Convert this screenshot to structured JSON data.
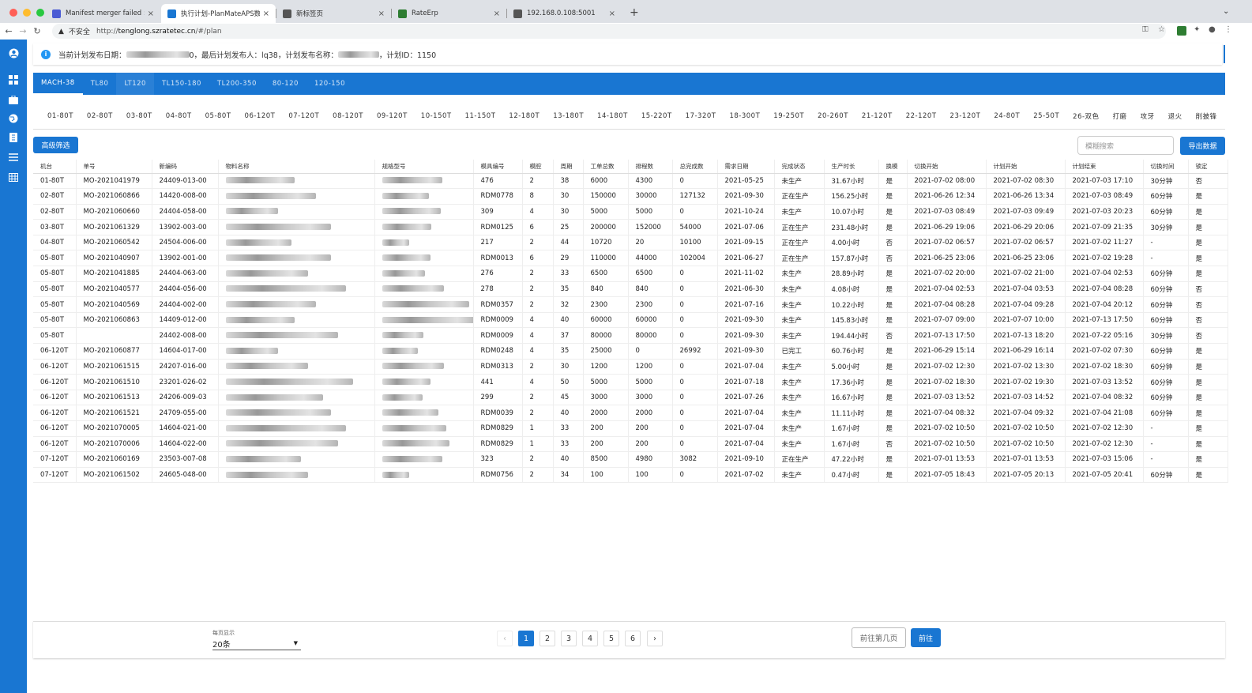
{
  "browser": {
    "tabs": [
      {
        "title": "Manifest merger failed : andro",
        "color": "#4a5bd4"
      },
      {
        "title": "执行计划-PlanMateAPS数据中心",
        "color": "#1976d2"
      },
      {
        "title": "新标签页",
        "color": "#555"
      },
      {
        "title": "RateErp",
        "color": "#2e7d32"
      },
      {
        "title": "192.168.0.108:5001",
        "color": "#555"
      }
    ],
    "insecure_label": "不安全",
    "url_prefix": "http://",
    "url_host": "tenglong.szratetec.cn",
    "url_path": "/#/plan"
  },
  "info": {
    "text_a": "当前计划发布日期：",
    "text_b": "0，最后计划发布人：lq38，计划发布名称：",
    "text_c": "，计划ID：1150"
  },
  "machine_tabs": [
    "MACH-38",
    "TL80",
    "LT120",
    "TL150-180",
    "TL200-350",
    "80-120",
    "120-150"
  ],
  "sub_tabs": [
    "01-80T",
    "02-80T",
    "03-80T",
    "04-80T",
    "05-80T",
    "06-120T",
    "07-120T",
    "08-120T",
    "09-120T",
    "10-150T",
    "11-150T",
    "12-180T",
    "13-180T",
    "14-180T",
    "15-220T",
    "17-320T",
    "18-300T",
    "19-250T",
    "20-260T",
    "21-120T",
    "22-120T",
    "23-120T",
    "24-80T",
    "25-50T",
    "26-双色",
    "打磨",
    "攻牙",
    "退火",
    "削披锋"
  ],
  "toolbar": {
    "filter_label": "高级筛选",
    "search_placeholder": "模糊搜索",
    "export_label": "导出数据"
  },
  "table": {
    "columns": [
      "机台",
      "单号",
      "新编码",
      "物料名称",
      "规格型号",
      "模具编号",
      "模腔",
      "周期",
      "工单总数",
      "排程数",
      "总完成数",
      "需求日期",
      "完成状态",
      "生产时长",
      "换模",
      "切换开始",
      "计划开始",
      "计划结束",
      "切换时间",
      "锁定"
    ],
    "rows": [
      [
        "01-80T",
        "MO-2021041979",
        "24409-013-00",
        "",
        "",
        "476",
        "2",
        "38",
        "6000",
        "4300",
        "0",
        "2021-05-25",
        "未生产",
        "31.67小时",
        "是",
        "2021-07-02 08:00",
        "2021-07-02 08:30",
        "2021-07-03 17:10",
        "30分钟",
        "否"
      ],
      [
        "02-80T",
        "MO-2021060866",
        "14420-008-00",
        "",
        "",
        "RDM0778",
        "8",
        "30",
        "150000",
        "30000",
        "127132",
        "2021-09-30",
        "正在生产",
        "156.25小时",
        "是",
        "2021-06-26 12:34",
        "2021-06-26 13:34",
        "2021-07-03 08:49",
        "60分钟",
        "是"
      ],
      [
        "02-80T",
        "MO-2021060660",
        "24404-058-00",
        "",
        "",
        "309",
        "4",
        "30",
        "5000",
        "5000",
        "0",
        "2021-10-24",
        "未生产",
        "10.07小时",
        "是",
        "2021-07-03 08:49",
        "2021-07-03 09:49",
        "2021-07-03 20:23",
        "60分钟",
        "是"
      ],
      [
        "03-80T",
        "MO-2021061329",
        "13902-003-00",
        "",
        "",
        "RDM0125",
        "6",
        "25",
        "200000",
        "152000",
        "54000",
        "2021-07-06",
        "正在生产",
        "231.48小时",
        "是",
        "2021-06-29 19:06",
        "2021-06-29 20:06",
        "2021-07-09 21:35",
        "30分钟",
        "是"
      ],
      [
        "04-80T",
        "MO-2021060542",
        "24504-006-00",
        "",
        "",
        "217",
        "2",
        "44",
        "10720",
        "20",
        "10100",
        "2021-09-15",
        "正在生产",
        "4.00小时",
        "否",
        "2021-07-02 06:57",
        "2021-07-02 06:57",
        "2021-07-02 11:27",
        "-",
        "是"
      ],
      [
        "05-80T",
        "MO-2021040907",
        "13902-001-00",
        "",
        "",
        "RDM0013",
        "6",
        "29",
        "110000",
        "44000",
        "102004",
        "2021-06-27",
        "正在生产",
        "157.87小时",
        "否",
        "2021-06-25 23:06",
        "2021-06-25 23:06",
        "2021-07-02 19:28",
        "-",
        "是"
      ],
      [
        "05-80T",
        "MO-2021041885",
        "24404-063-00",
        "",
        "",
        "276",
        "2",
        "33",
        "6500",
        "6500",
        "0",
        "2021-11-02",
        "未生产",
        "28.89小时",
        "是",
        "2021-07-02 20:00",
        "2021-07-02 21:00",
        "2021-07-04 02:53",
        "60分钟",
        "是"
      ],
      [
        "05-80T",
        "MO-2021040577",
        "24404-056-00",
        "",
        "",
        "278",
        "2",
        "35",
        "840",
        "840",
        "0",
        "2021-06-30",
        "未生产",
        "4.08小时",
        "是",
        "2021-07-04 02:53",
        "2021-07-04 03:53",
        "2021-07-04 08:28",
        "60分钟",
        "否"
      ],
      [
        "05-80T",
        "MO-2021040569",
        "24404-002-00",
        "",
        "",
        "RDM0357",
        "2",
        "32",
        "2300",
        "2300",
        "0",
        "2021-07-16",
        "未生产",
        "10.22小时",
        "是",
        "2021-07-04 08:28",
        "2021-07-04 09:28",
        "2021-07-04 20:12",
        "60分钟",
        "否"
      ],
      [
        "05-80T",
        "MO-2021060863",
        "14409-012-00",
        "",
        "",
        "RDM0009",
        "4",
        "40",
        "60000",
        "60000",
        "0",
        "2021-09-30",
        "未生产",
        "145.83小时",
        "是",
        "2021-07-07 09:00",
        "2021-07-07 10:00",
        "2021-07-13 17:50",
        "60分钟",
        "否"
      ],
      [
        "05-80T",
        "",
        "24402-008-00",
        "",
        "",
        "RDM0009",
        "4",
        "37",
        "80000",
        "80000",
        "0",
        "2021-09-30",
        "未生产",
        "194.44小时",
        "否",
        "2021-07-13 17:50",
        "2021-07-13 18:20",
        "2021-07-22 05:16",
        "30分钟",
        "否"
      ],
      [
        "06-120T",
        "MO-2021060877",
        "14604-017-00",
        "",
        "",
        "RDM0248",
        "4",
        "35",
        "25000",
        "0",
        "26992",
        "2021-09-30",
        "已完工",
        "60.76小时",
        "是",
        "2021-06-29 15:14",
        "2021-06-29 16:14",
        "2021-07-02 07:30",
        "60分钟",
        "是"
      ],
      [
        "06-120T",
        "MO-2021061515",
        "24207-016-00",
        "",
        "",
        "RDM0313",
        "2",
        "30",
        "1200",
        "1200",
        "0",
        "2021-07-04",
        "未生产",
        "5.00小时",
        "是",
        "2021-07-02 12:30",
        "2021-07-02 13:30",
        "2021-07-02 18:30",
        "60分钟",
        "是"
      ],
      [
        "06-120T",
        "MO-2021061510",
        "23201-026-02",
        "",
        "",
        "441",
        "4",
        "50",
        "5000",
        "5000",
        "0",
        "2021-07-18",
        "未生产",
        "17.36小时",
        "是",
        "2021-07-02 18:30",
        "2021-07-02 19:30",
        "2021-07-03 13:52",
        "60分钟",
        "是"
      ],
      [
        "06-120T",
        "MO-2021061513",
        "24206-009-03",
        "",
        "",
        "299",
        "2",
        "45",
        "3000",
        "3000",
        "0",
        "2021-07-26",
        "未生产",
        "16.67小时",
        "是",
        "2021-07-03 13:52",
        "2021-07-03 14:52",
        "2021-07-04 08:32",
        "60分钟",
        "是"
      ],
      [
        "06-120T",
        "MO-2021061521",
        "24709-055-00",
        "",
        "",
        "RDM0039",
        "2",
        "40",
        "2000",
        "2000",
        "0",
        "2021-07-04",
        "未生产",
        "11.11小时",
        "是",
        "2021-07-04 08:32",
        "2021-07-04 09:32",
        "2021-07-04 21:08",
        "60分钟",
        "是"
      ],
      [
        "06-120T",
        "MO-2021070005",
        "14604-021-00",
        "",
        "",
        "RDM0829",
        "1",
        "33",
        "200",
        "200",
        "0",
        "2021-07-04",
        "未生产",
        "1.67小时",
        "是",
        "2021-07-02 10:50",
        "2021-07-02 10:50",
        "2021-07-02 12:30",
        "-",
        "是"
      ],
      [
        "06-120T",
        "MO-2021070006",
        "14604-022-00",
        "",
        "",
        "RDM0829",
        "1",
        "33",
        "200",
        "200",
        "0",
        "2021-07-04",
        "未生产",
        "1.67小时",
        "否",
        "2021-07-02 10:50",
        "2021-07-02 10:50",
        "2021-07-02 12:30",
        "-",
        "是"
      ],
      [
        "07-120T",
        "MO-2021060169",
        "23503-007-08",
        "",
        "",
        "323",
        "2",
        "40",
        "8500",
        "4980",
        "3082",
        "2021-09-10",
        "正在生产",
        "47.22小时",
        "是",
        "2021-07-01 13:53",
        "2021-07-01 13:53",
        "2021-07-03 15:06",
        "-",
        "是"
      ],
      [
        "07-120T",
        "MO-2021061502",
        "24605-048-00",
        "",
        "",
        "RDM0756",
        "2",
        "34",
        "100",
        "100",
        "0",
        "2021-07-02",
        "未生产",
        "0.47小时",
        "是",
        "2021-07-05 18:43",
        "2021-07-05 20:13",
        "2021-07-05 20:41",
        "60分钟",
        "是"
      ]
    ]
  },
  "pagination": {
    "per_page_label": "每页显示",
    "per_page_value": "20条",
    "pages": [
      "1",
      "2",
      "3",
      "4",
      "5",
      "6"
    ],
    "current_page": "1",
    "jump_placeholder": "前往第几页",
    "jump_button": "前往"
  }
}
